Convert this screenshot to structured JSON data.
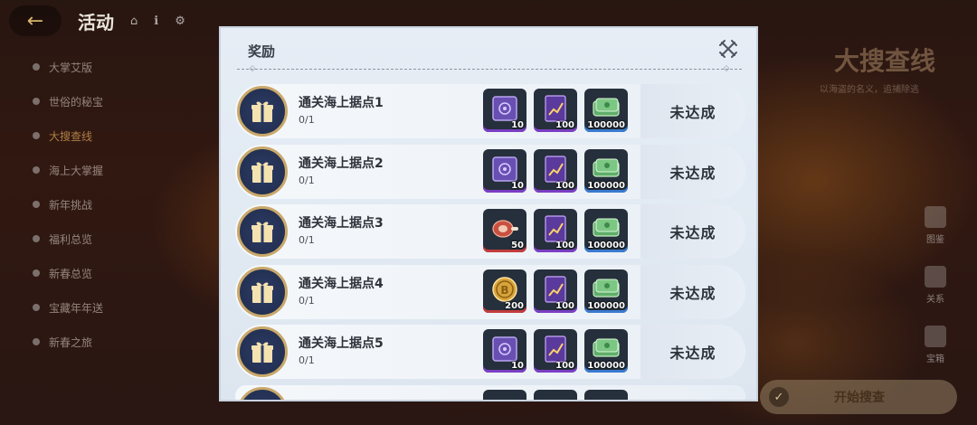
{
  "header": {
    "title": "活动"
  },
  "sidebar": {
    "items": [
      {
        "label": "大掌艾版"
      },
      {
        "label": "世俗的秘宝"
      },
      {
        "label": "大搜查线"
      },
      {
        "label": "海上大掌握"
      },
      {
        "label": "新年挑战"
      },
      {
        "label": "福利总览"
      },
      {
        "label": "新春总览"
      },
      {
        "label": "宝藏年年送"
      },
      {
        "label": "新春之旅"
      }
    ]
  },
  "background": {
    "title": "大搜查线",
    "subtitle": "以海盗的名义，追捕除逃",
    "right_icons": [
      "图鉴",
      "关系",
      "宝箱"
    ],
    "start_button": "开始搜查"
  },
  "modal": {
    "title": "奖励",
    "close_icon": "crossed-swords-close-icon",
    "rows": [
      {
        "name": "通关海上据点1",
        "progress": "0/1",
        "status": "未达成",
        "rewards": [
          {
            "icon": "purple-box-icon",
            "qty": "10",
            "rarity": "purple"
          },
          {
            "icon": "purple-book-icon",
            "qty": "100",
            "rarity": "purple"
          },
          {
            "icon": "cash-bundle-icon",
            "qty": "100000",
            "rarity": "blue"
          }
        ]
      },
      {
        "name": "通关海上据点2",
        "progress": "0/1",
        "status": "未达成",
        "rewards": [
          {
            "icon": "purple-box-icon",
            "qty": "10",
            "rarity": "purple"
          },
          {
            "icon": "purple-book-icon",
            "qty": "100",
            "rarity": "purple"
          },
          {
            "icon": "cash-bundle-icon",
            "qty": "100000",
            "rarity": "blue"
          }
        ]
      },
      {
        "name": "通关海上据点3",
        "progress": "0/1",
        "status": "未达成",
        "rewards": [
          {
            "icon": "meat-icon",
            "qty": "50",
            "rarity": "red"
          },
          {
            "icon": "purple-book-icon",
            "qty": "100",
            "rarity": "purple"
          },
          {
            "icon": "cash-bundle-icon",
            "qty": "100000",
            "rarity": "blue"
          }
        ]
      },
      {
        "name": "通关海上据点4",
        "progress": "0/1",
        "status": "未达成",
        "rewards": [
          {
            "icon": "gold-coin-icon",
            "qty": "200",
            "rarity": "red"
          },
          {
            "icon": "purple-book-icon",
            "qty": "100",
            "rarity": "purple"
          },
          {
            "icon": "cash-bundle-icon",
            "qty": "100000",
            "rarity": "blue"
          }
        ]
      },
      {
        "name": "通关海上据点5",
        "progress": "0/1",
        "status": "未达成",
        "rewards": [
          {
            "icon": "purple-box-icon",
            "qty": "10",
            "rarity": "purple"
          },
          {
            "icon": "purple-book-icon",
            "qty": "100",
            "rarity": "purple"
          },
          {
            "icon": "cash-bundle-icon",
            "qty": "100000",
            "rarity": "blue"
          }
        ]
      }
    ]
  },
  "colors": {
    "modal_bg": "#e6edf5",
    "gift_circle": "#243154",
    "gift_ring": "#c9a86a",
    "rarity_purple": "#7b3ec4",
    "rarity_red": "#c33c3c",
    "rarity_blue": "#3a7ad0"
  }
}
